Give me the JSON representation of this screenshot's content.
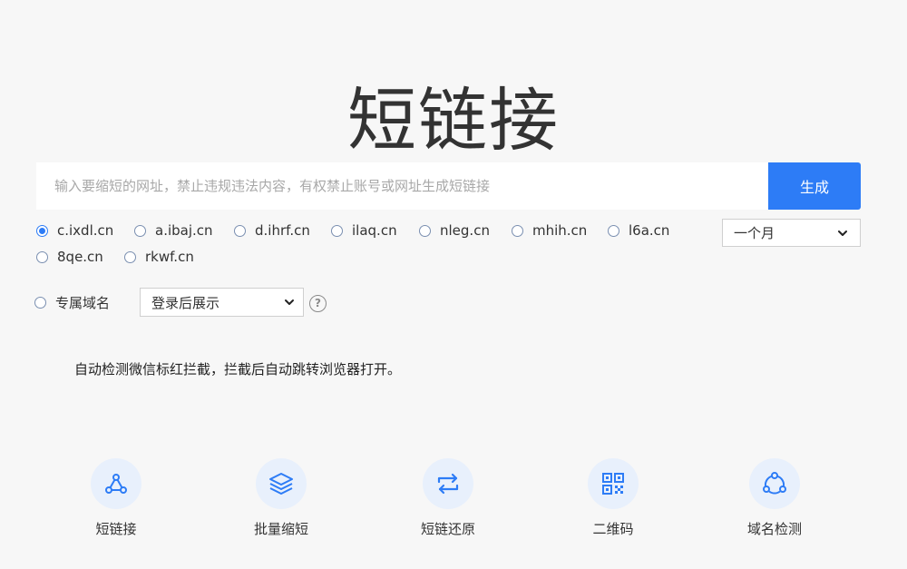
{
  "header": {
    "title": "短链接"
  },
  "search": {
    "placeholder": "输入要缩短的网址，禁止违规违法内容，有权禁止账号或网址生成短链接",
    "value": "",
    "generate_label": "生成"
  },
  "domains": [
    {
      "label": "c.ixdl.cn",
      "checked": true
    },
    {
      "label": "a.ibaj.cn",
      "checked": false
    },
    {
      "label": "d.ihrf.cn",
      "checked": false
    },
    {
      "label": "ilaq.cn",
      "checked": false
    },
    {
      "label": "nleg.cn",
      "checked": false
    },
    {
      "label": "mhih.cn",
      "checked": false
    },
    {
      "label": "l6a.cn",
      "checked": false
    },
    {
      "label": "8qe.cn",
      "checked": false
    },
    {
      "label": "rkwf.cn",
      "checked": false
    }
  ],
  "duration": {
    "selected": "一个月"
  },
  "custom_domain": {
    "label": "专属域名",
    "select_value": "登录后展示",
    "help_symbol": "?"
  },
  "notice": {
    "text": "自动检测微信标红拦截，拦截后自动跳转浏览器打开。"
  },
  "features": [
    {
      "label": "短链接",
      "icon": "share-nodes-icon"
    },
    {
      "label": "批量缩短",
      "icon": "layers-icon"
    },
    {
      "label": "短链还原",
      "icon": "swap-arrows-icon"
    },
    {
      "label": "二维码",
      "icon": "qr-code-icon"
    },
    {
      "label": "域名检测",
      "icon": "network-cycle-icon"
    }
  ],
  "colors": {
    "accent": "#2d7cf6",
    "icon_bg": "#e8f0fc",
    "page_bg": "#f7f7f7"
  }
}
